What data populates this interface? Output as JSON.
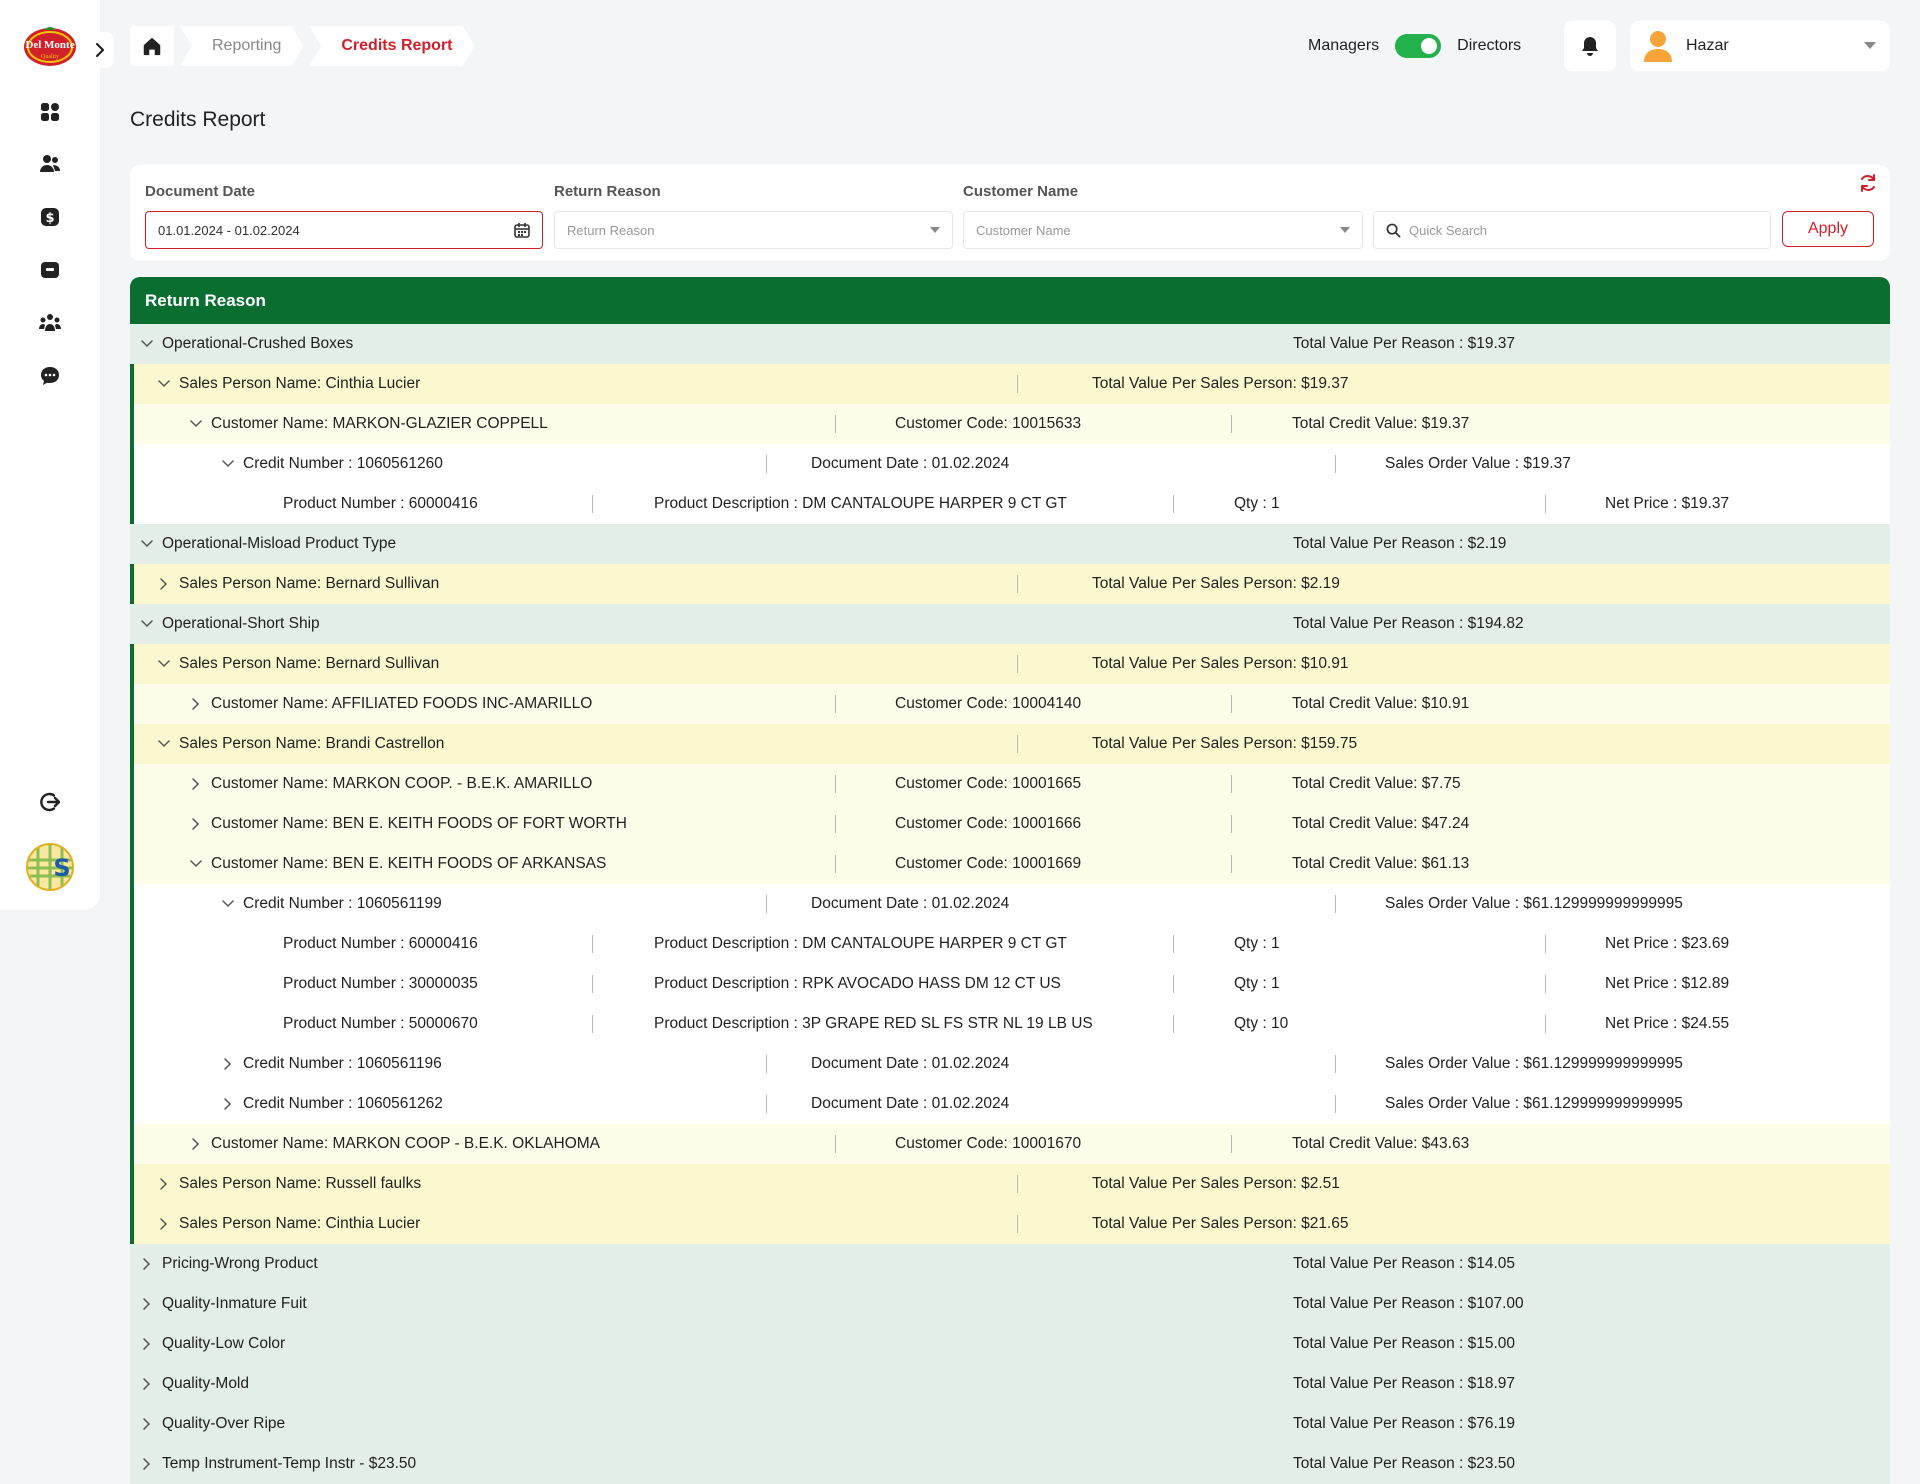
{
  "brand": {
    "logo_text": "Del Monte",
    "logo_sub": "Quality"
  },
  "nav": {
    "items": [
      "dashboard-icon",
      "users-icon",
      "dollar-icon",
      "toolbox-icon",
      "team-icon",
      "feedback-icon"
    ],
    "logout": "logout-icon"
  },
  "breadcrumb": {
    "items": [
      "Reporting",
      "Credits Report"
    ]
  },
  "role_toggle": {
    "left": "Managers",
    "right": "Directors",
    "on": true
  },
  "user": {
    "name": "Hazar"
  },
  "page": {
    "title": "Credits Report"
  },
  "filters": {
    "document_date": {
      "label": "Document Date",
      "value": "01.01.2024 - 01.02.2024"
    },
    "return_reason": {
      "label": "Return Reason",
      "placeholder": "Return Reason"
    },
    "customer_name": {
      "label": "Customer Name",
      "placeholder": "Customer Name"
    },
    "search": {
      "placeholder": "Quick Search"
    },
    "apply_label": "Apply"
  },
  "table": {
    "header": "Return Reason",
    "rows": [
      {
        "level": 1,
        "expanded": true,
        "cells": [
          "Operational-Crushed Boxes",
          "Total Value Per Reason : $19.37"
        ]
      },
      {
        "level": 2,
        "expanded": true,
        "cells": [
          "Sales Person Name: Cinthia Lucier",
          "Total Value Per Sales Person: $19.37"
        ]
      },
      {
        "level": 3,
        "expanded": true,
        "cells": [
          "Customer Name: MARKON-GLAZIER COPPELL",
          "Customer Code: 10015633",
          "Total Credit Value: $19.37"
        ]
      },
      {
        "level": 4,
        "expanded": true,
        "cells": [
          "Credit Number : 1060561260",
          "Document Date : 01.02.2024",
          "Sales Order Value : $19.37"
        ]
      },
      {
        "level": 5,
        "cells": [
          "Product Number : 60000416",
          "Product Description : DM CANTALOUPE HARPER 9 CT GT",
          "Qty : 1",
          "Net Price : $19.37"
        ]
      },
      {
        "level": 1,
        "expanded": true,
        "cells": [
          "Operational-Misload Product Type",
          "Total Value Per Reason : $2.19"
        ]
      },
      {
        "level": 2,
        "expanded": false,
        "cells": [
          "Sales Person Name: Bernard Sullivan",
          "Total Value Per Sales Person: $2.19"
        ]
      },
      {
        "level": 1,
        "expanded": true,
        "cells": [
          "Operational-Short Ship",
          "Total Value Per Reason : $194.82"
        ]
      },
      {
        "level": 2,
        "expanded": true,
        "cells": [
          "Sales Person Name: Bernard Sullivan",
          "Total Value Per Sales Person: $10.91"
        ]
      },
      {
        "level": 3,
        "expanded": false,
        "cells": [
          "Customer Name: AFFILIATED FOODS INC-AMARILLO",
          "Customer Code: 10004140",
          "Total Credit Value: $10.91"
        ]
      },
      {
        "level": 2,
        "expanded": true,
        "cells": [
          "Sales Person Name: Brandi Castrellon",
          "Total Value Per Sales Person: $159.75"
        ]
      },
      {
        "level": 3,
        "expanded": false,
        "cells": [
          "Customer Name: MARKON COOP. - B.E.K. AMARILLO",
          "Customer Code: 10001665",
          "Total Credit Value: $7.75"
        ]
      },
      {
        "level": 3,
        "expanded": false,
        "cells": [
          "Customer Name: BEN E. KEITH FOODS OF FORT WORTH",
          "Customer Code: 10001666",
          "Total Credit Value: $47.24"
        ]
      },
      {
        "level": 3,
        "expanded": true,
        "cells": [
          "Customer Name: BEN E. KEITH FOODS OF ARKANSAS",
          "Customer Code: 10001669",
          "Total Credit Value: $61.13"
        ]
      },
      {
        "level": 4,
        "expanded": true,
        "cells": [
          "Credit Number : 1060561199",
          "Document Date : 01.02.2024",
          "Sales Order Value : $61.129999999999995"
        ]
      },
      {
        "level": 5,
        "cells": [
          "Product Number : 60000416",
          "Product Description : DM CANTALOUPE HARPER 9 CT GT",
          "Qty : 1",
          "Net Price : $23.69"
        ]
      },
      {
        "level": 5,
        "cells": [
          "Product Number : 30000035",
          "Product Description : RPK AVOCADO HASS DM 12 CT US",
          "Qty : 1",
          "Net Price : $12.89"
        ]
      },
      {
        "level": 5,
        "cells": [
          "Product Number : 50000670",
          "Product Description : 3P GRAPE RED SL FS STR NL 19 LB US",
          "Qty : 10",
          "Net Price : $24.55"
        ]
      },
      {
        "level": 4,
        "expanded": false,
        "cells": [
          "Credit Number : 1060561196",
          "Document Date : 01.02.2024",
          "Sales Order Value : $61.129999999999995"
        ]
      },
      {
        "level": 4,
        "expanded": false,
        "cells": [
          "Credit Number : 1060561262",
          "Document Date : 01.02.2024",
          "Sales Order Value : $61.129999999999995"
        ]
      },
      {
        "level": 3,
        "expanded": false,
        "cells": [
          "Customer Name: MARKON COOP - B.E.K. OKLAHOMA",
          "Customer Code: 10001670",
          "Total Credit Value: $43.63"
        ]
      },
      {
        "level": 2,
        "expanded": false,
        "cells": [
          "Sales Person Name: Russell faulks",
          "Total Value Per Sales Person: $2.51"
        ]
      },
      {
        "level": 2,
        "expanded": false,
        "cells": [
          "Sales Person Name: Cinthia Lucier",
          "Total Value Per Sales Person: $21.65"
        ]
      },
      {
        "level": 1,
        "expanded": false,
        "cells": [
          "Pricing-Wrong Product",
          "Total Value Per Reason : $14.05"
        ]
      },
      {
        "level": 1,
        "expanded": false,
        "cells": [
          "Quality-Inmature Fuit",
          "Total Value Per Reason : $107.00"
        ]
      },
      {
        "level": 1,
        "expanded": false,
        "cells": [
          "Quality-Low Color",
          "Total Value Per Reason : $15.00"
        ]
      },
      {
        "level": 1,
        "expanded": false,
        "cells": [
          "Quality-Mold",
          "Total Value Per Reason : $18.97"
        ]
      },
      {
        "level": 1,
        "expanded": false,
        "cells": [
          "Quality-Over Ripe",
          "Total Value Per Reason : $76.19"
        ]
      },
      {
        "level": 1,
        "expanded": false,
        "cells": [
          "Temp Instrument-Temp Instr - $23.50",
          "Total Value Per Reason : $23.50"
        ]
      }
    ]
  },
  "colors": {
    "accent": "#d0202a",
    "header_green": "#0a6e31",
    "toggle_green": "#22b14c"
  }
}
